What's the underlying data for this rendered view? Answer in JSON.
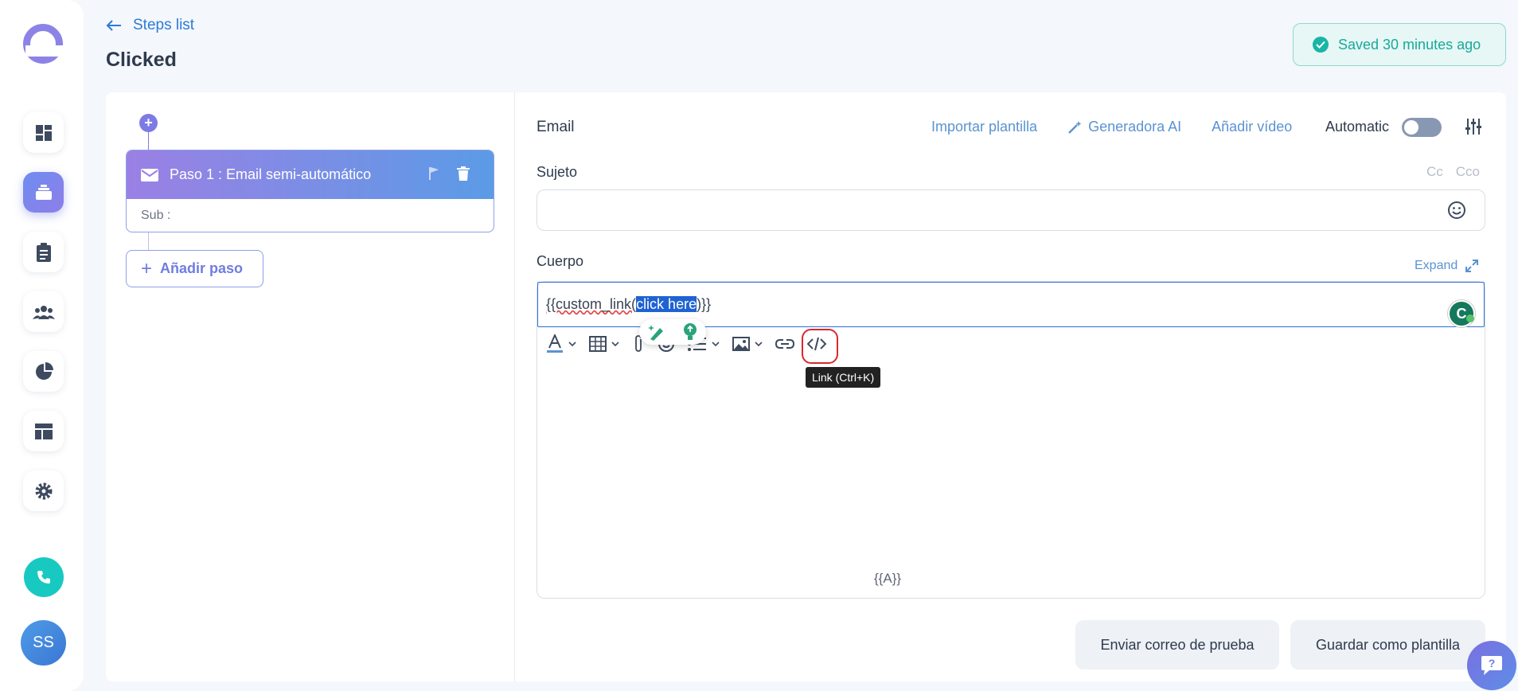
{
  "nav": {
    "back_label": "Steps list",
    "page_title": "Clicked",
    "saved_status": "Saved 30 minutes ago",
    "avatar_initials": "SS"
  },
  "sidebar": {
    "items": [
      {
        "name": "dashboard-icon",
        "active": false
      },
      {
        "name": "sequences-icon",
        "active": true
      },
      {
        "name": "tasks-icon",
        "active": false
      },
      {
        "name": "contacts-icon",
        "active": false
      },
      {
        "name": "reports-icon",
        "active": false
      },
      {
        "name": "templates-icon",
        "active": false
      },
      {
        "name": "settings-icon",
        "active": false
      }
    ]
  },
  "steps": {
    "step1_title": "Paso 1 : Email semi-automático",
    "step1_sub": "Sub :",
    "add_step_label": "Añadir paso"
  },
  "editor": {
    "section_title": "Email",
    "import_template": "Importar plantilla",
    "ai_generator": "Generadora AI",
    "add_video": "Añadir vídeo",
    "automatic_label": "Automatic",
    "automatic_on": false,
    "subject_label": "Sujeto",
    "cc_label": "Cc",
    "cco_label": "Cco",
    "subject_value": "",
    "body_label": "Cuerpo",
    "expand_label": "Expand",
    "body_text_prefix": "{{custom_link(",
    "body_text_selected": "click here",
    "body_text_suffix": ")}}",
    "tooltip": "Link (Ctrl+K)",
    "footer_placeholder": "{{A}}",
    "grammarly_letter": "C"
  },
  "actions": {
    "send_test": "Enviar correo de prueba",
    "save_template": "Guardar como plantilla"
  },
  "colors": {
    "accent": "#2b7bd9",
    "primary_purple": "#7c7be4",
    "saved_green": "#19a89a",
    "selection_blue": "#1f63d2",
    "highlight_red": "#d9272e"
  }
}
